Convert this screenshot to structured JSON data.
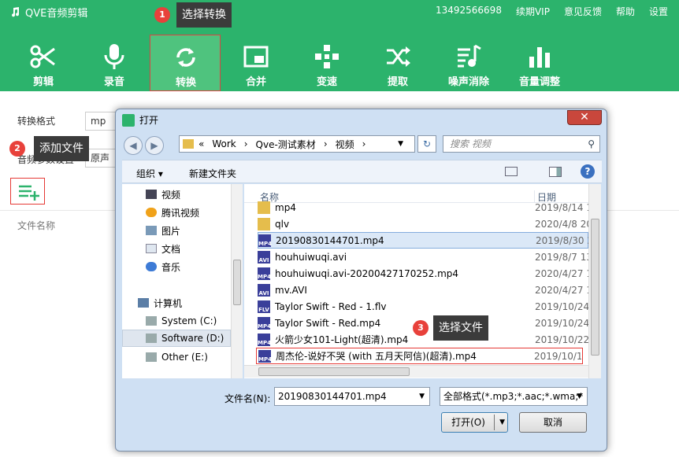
{
  "app": {
    "title": "QVE音频剪辑",
    "phone": "13492566698",
    "links": [
      "续期VIP",
      "意见反馈",
      "帮助",
      "设置"
    ]
  },
  "toolbar": [
    {
      "label": "剪辑",
      "icon": "scissors-icon"
    },
    {
      "label": "录音",
      "icon": "microphone-icon"
    },
    {
      "label": "转换",
      "icon": "convert-icon",
      "active": true
    },
    {
      "label": "合并",
      "icon": "merge-icon"
    },
    {
      "label": "变速",
      "icon": "speed-icon"
    },
    {
      "label": "提取",
      "icon": "extract-icon"
    },
    {
      "label": "噪声消除",
      "icon": "noise-removal-icon"
    },
    {
      "label": "音量调整",
      "icon": "volume-adjust-icon"
    }
  ],
  "steps": [
    {
      "num": "1",
      "text": "选择转换"
    },
    {
      "num": "2",
      "text": "添加文件"
    },
    {
      "num": "3",
      "text": "选择文件"
    }
  ],
  "form": {
    "format_label": "转换格式",
    "format_value": "mp",
    "params_label": "音频参数设置",
    "params_value": "原声"
  },
  "list": {
    "col_name": "文件名称"
  },
  "dialog": {
    "title": "打开",
    "address": [
      "«",
      "Work",
      "›",
      "Qve-测试素材",
      "›",
      "视频",
      "›"
    ],
    "search_placeholder": "搜索 视频",
    "organize": "组织 ▾",
    "new_folder": "新建文件夹",
    "nav_items": [
      {
        "label": "视频",
        "icon": "video-library-icon"
      },
      {
        "label": "腾讯视频",
        "icon": "tencent-video-icon"
      },
      {
        "label": "图片",
        "icon": "pictures-icon"
      },
      {
        "label": "文档",
        "icon": "documents-icon"
      },
      {
        "label": "音乐",
        "icon": "music-icon"
      },
      {
        "label": "计算机",
        "icon": "computer-icon"
      },
      {
        "label": "System (C:)",
        "icon": "drive-icon"
      },
      {
        "label": "Software (D:)",
        "icon": "drive-icon",
        "selected": true
      },
      {
        "label": "Other (E:)",
        "icon": "drive-icon"
      }
    ],
    "columns": {
      "name": "名称",
      "date": "日期"
    },
    "files": [
      {
        "name": "mp4",
        "date": "2019/8/14 1",
        "type": "folder"
      },
      {
        "name": "qlv",
        "date": "2020/4/8 20",
        "type": "folder"
      },
      {
        "name": "20190830144701.mp4",
        "date": "2019/8/30 2",
        "type": "MP4",
        "selected": true
      },
      {
        "name": "houhuiwuqi.avi",
        "date": "2019/8/7 13",
        "type": "AVI"
      },
      {
        "name": "houhuiwuqi.avi-20200427170252.mp4",
        "date": "2020/4/27 1",
        "type": "MP4"
      },
      {
        "name": "mv.AVI",
        "date": "2020/4/27 1",
        "type": "AVI"
      },
      {
        "name": "Taylor Swift - Red - 1.flv",
        "date": "2019/10/24",
        "type": "FLV"
      },
      {
        "name": "Taylor Swift - Red.mp4",
        "date": "2019/10/24",
        "type": "MP4"
      },
      {
        "name": "火箭少女101-Light(超清).mp4",
        "date": "2019/10/22",
        "type": "MP4"
      },
      {
        "name": "周杰伦-说好不哭 (with 五月天阿信)(超清).mp4",
        "date": "2019/10/11",
        "type": "MP4",
        "highlighted": true
      }
    ],
    "filename_label": "文件名(N):",
    "filename_value": "20190830144701.mp4",
    "filetype_value": "全部格式(*.mp3;*.aac;*.wma;*",
    "open_label": "打开(O)",
    "cancel_label": "取消"
  },
  "colors": {
    "brand": "#2cb36c",
    "badge": "#e8413b",
    "highlight": "#e53935"
  }
}
